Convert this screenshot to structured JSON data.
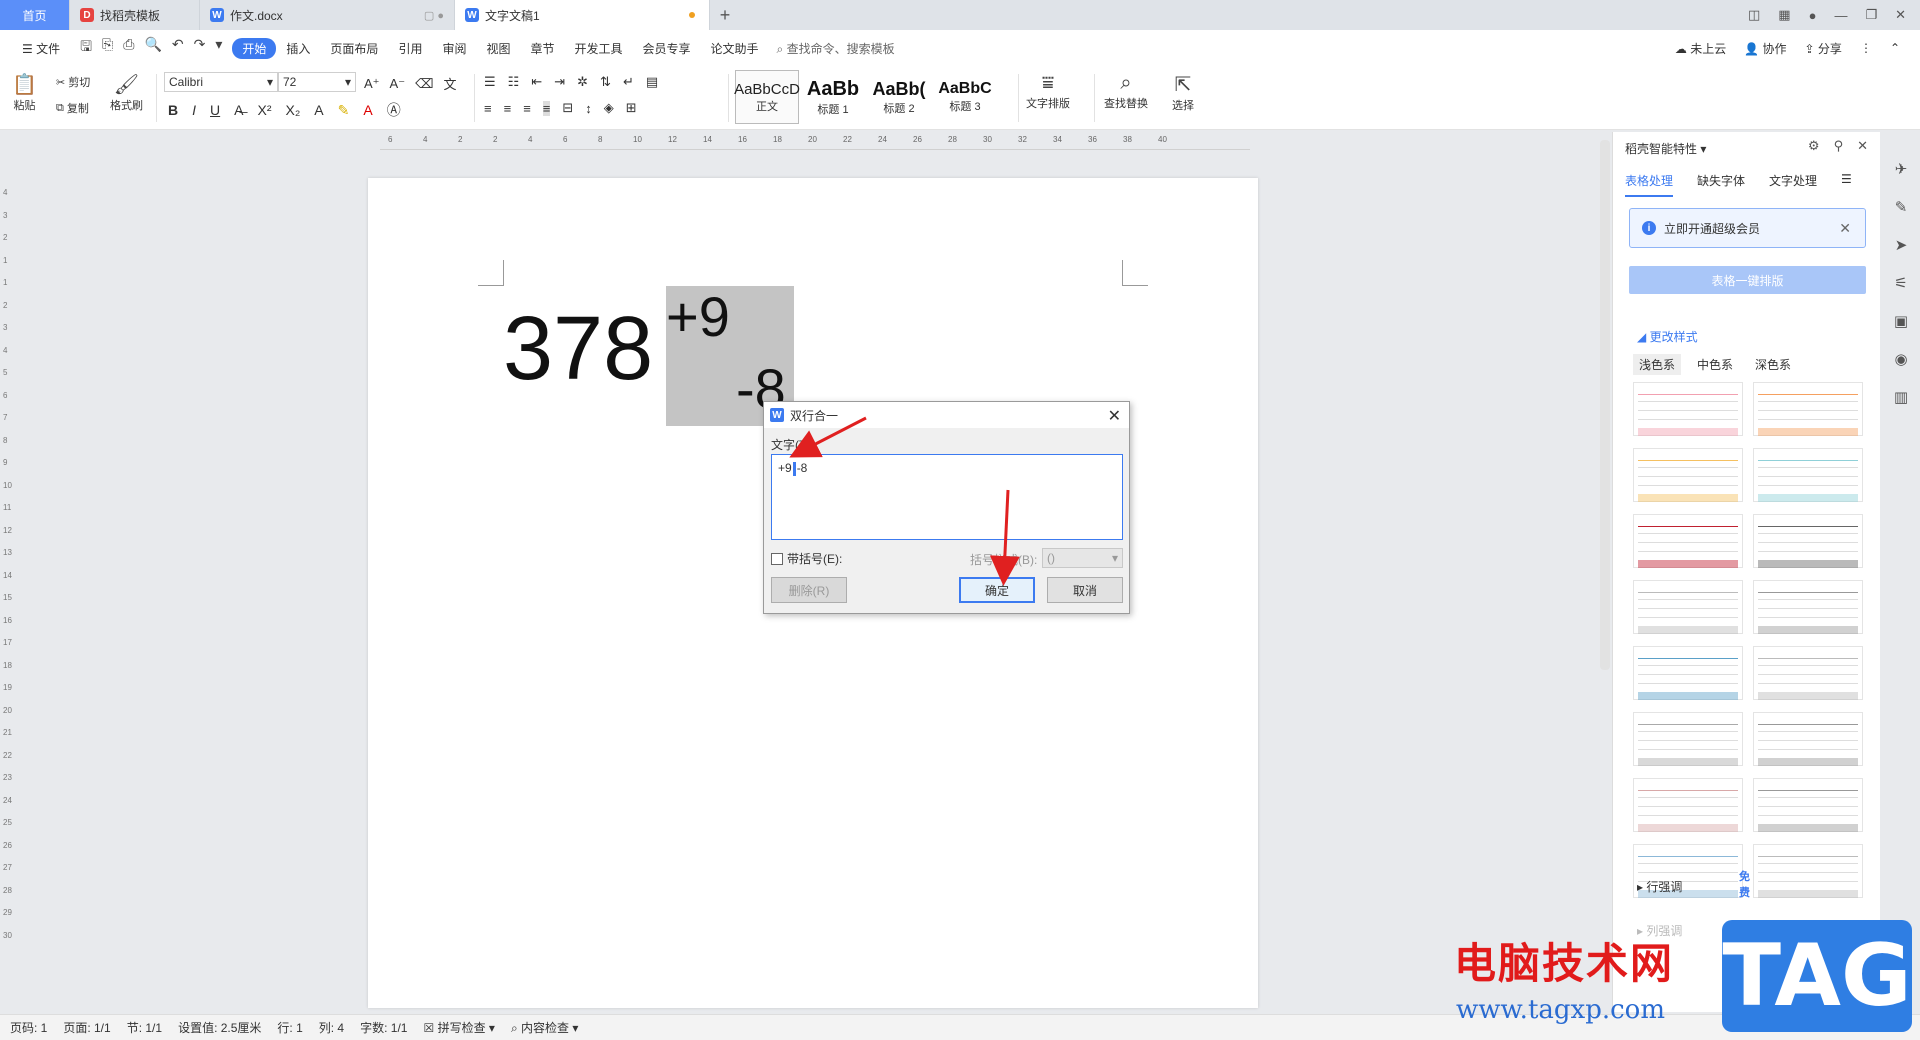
{
  "tabs": [
    {
      "label": "首页"
    },
    {
      "label": "找稻壳模板"
    },
    {
      "label": "作文.docx"
    },
    {
      "label": "文字文稿1"
    }
  ],
  "menu": {
    "file": "文件",
    "items": [
      "开始",
      "插入",
      "页面布局",
      "引用",
      "审阅",
      "视图",
      "章节",
      "开发工具",
      "会员专享",
      "论文助手"
    ],
    "search": "查找命令、搜索模板",
    "right": {
      "cloud": "未上云",
      "collab": "协作",
      "share": "分享"
    }
  },
  "ribbon": {
    "paste": "粘贴",
    "cut": "剪切",
    "copy": "复制",
    "format_painter": "格式刷",
    "font_name": "Calibri",
    "font_size": "72",
    "styles": [
      {
        "preview": "AaBbCcD",
        "label": "正文"
      },
      {
        "preview": "AaBb",
        "label": "标题 1"
      },
      {
        "preview": "AaBb(",
        "label": "标题 2"
      },
      {
        "preview": "AaBbC",
        "label": "标题 3"
      }
    ],
    "text_layout": "文字排版",
    "find_replace": "查找替换",
    "select": "选择"
  },
  "ruler_h": [
    "6",
    "4",
    "2",
    "2",
    "4",
    "6",
    "8",
    "10",
    "12",
    "14",
    "16",
    "18",
    "20",
    "22",
    "24",
    "26",
    "28",
    "30",
    "32",
    "34",
    "36",
    "38",
    "40"
  ],
  "ruler_v": [
    "4",
    "3",
    "2",
    "1",
    "1",
    "2",
    "3",
    "4",
    "5",
    "6",
    "7",
    "8",
    "9",
    "10",
    "11",
    "12",
    "13",
    "14",
    "15",
    "16",
    "17",
    "18",
    "19",
    "20",
    "21",
    "22",
    "23",
    "24",
    "25",
    "26",
    "27",
    "28",
    "29",
    "30"
  ],
  "document": {
    "main_text": "378",
    "top_text": "+9",
    "bottom_text": "-8"
  },
  "dialog": {
    "title": "双行合一",
    "text_label": "文字(T):",
    "text_before_caret": "+9",
    "text_after_caret": "-8",
    "bracket_check": "带括号(E):",
    "bracket_style_label": "括号样式(B):",
    "bracket_style_value": "()",
    "delete": "删除(R)",
    "ok": "确定",
    "cancel": "取消"
  },
  "panel": {
    "header": "稻壳智能特性",
    "tabs": [
      "表格处理",
      "缺失字体",
      "文字处理"
    ],
    "vip": "立即开通超级会员",
    "onekey": "表格一键排版",
    "change_style": "更改样式",
    "subtabs": [
      "浅色系",
      "中色系",
      "深色系"
    ],
    "free": "免费",
    "row_adjust": "行强调",
    "col_adjust": "列强调"
  },
  "status": {
    "page": "页码: 1",
    "pages": "页面: 1/1",
    "section": "节: 1/1",
    "setting": "设置值: 2.5厘米",
    "row": "行: 1",
    "col": "列: 4",
    "words": "字数: 1/1",
    "spell": "拼写检查",
    "content": "内容检查"
  },
  "watermark": {
    "cn": "电脑技术网",
    "url": "www.tagxp.com",
    "tag": "TAG"
  },
  "colors": {
    "accent": "#3c7af0",
    "arrow": "#e02020",
    "selection": "#c4c4c4"
  }
}
